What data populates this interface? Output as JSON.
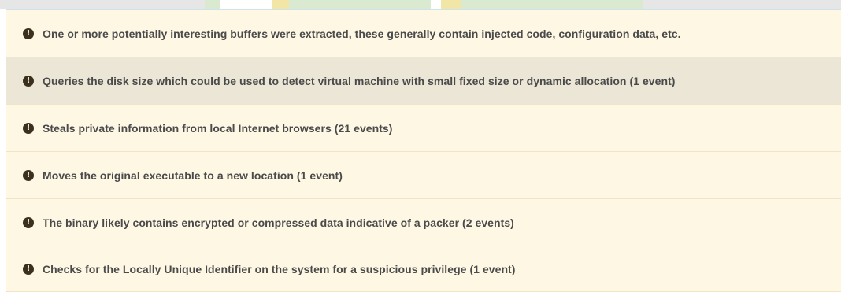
{
  "theme": {
    "row_bg": "#fdf7e4",
    "row_highlight_bg": "#ebe6d6",
    "icon_color": "#3b2f1e",
    "text_color": "#4a4a4a"
  },
  "signatures": [
    {
      "icon": "exclamation-circle-icon",
      "text": "One or more potentially interesting buffers were extracted, these generally contain injected code, configuration data, etc.",
      "highlighted": false
    },
    {
      "icon": "exclamation-circle-icon",
      "text": "Queries the disk size which could be used to detect virtual machine with small fixed size or dynamic allocation (1 event)",
      "highlighted": true
    },
    {
      "icon": "exclamation-circle-icon",
      "text": "Steals private information from local Internet browsers (21 events)",
      "highlighted": false
    },
    {
      "icon": "exclamation-circle-icon",
      "text": "Moves the original executable to a new location (1 event)",
      "highlighted": false
    },
    {
      "icon": "exclamation-circle-icon",
      "text": "The binary likely contains encrypted or compressed data indicative of a packer (2 events)",
      "highlighted": false
    },
    {
      "icon": "exclamation-circle-icon",
      "text": "Checks for the Locally Unique Identifier on the system for a suspicious privilege (1 event)",
      "highlighted": false
    }
  ]
}
